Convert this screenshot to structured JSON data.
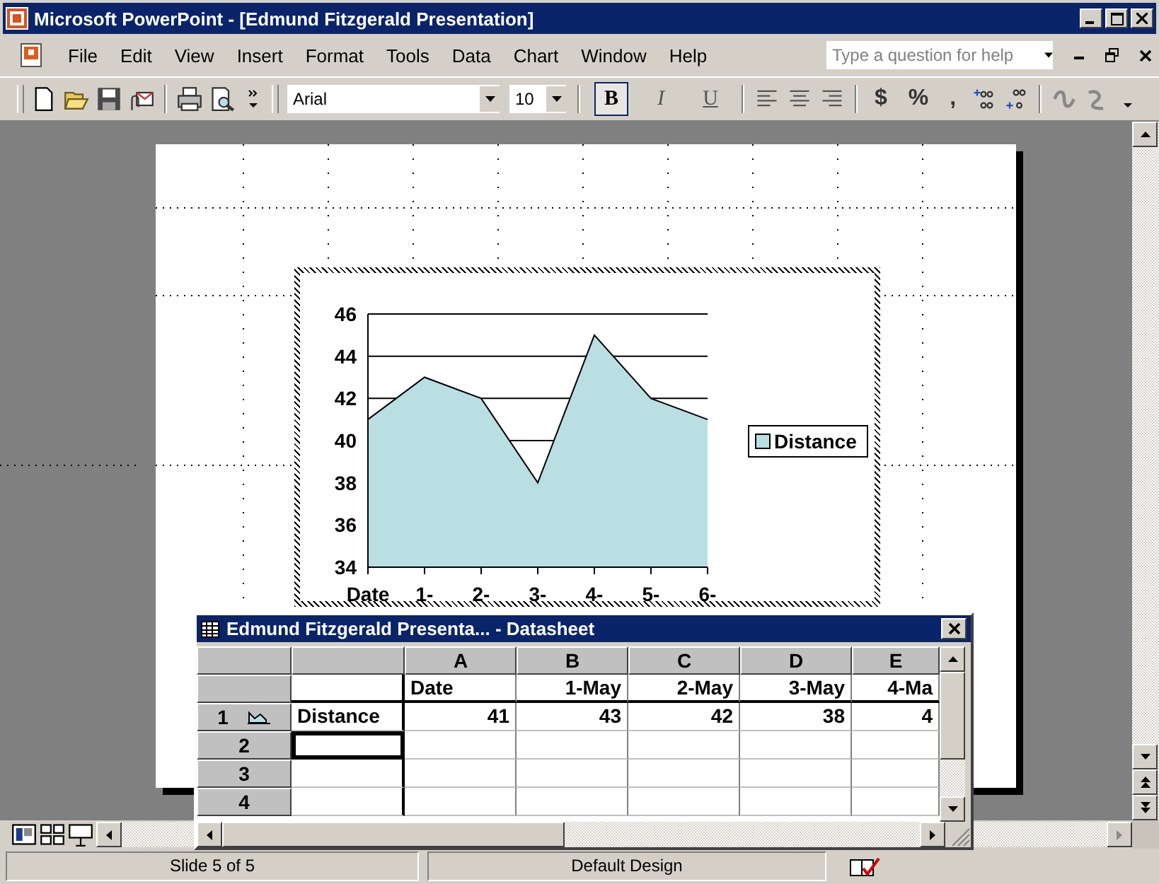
{
  "window": {
    "title": "Microsoft PowerPoint - [Edmund Fitzgerald Presentation]"
  },
  "menu": [
    "File",
    "Edit",
    "View",
    "Insert",
    "Format",
    "Tools",
    "Data",
    "Chart",
    "Window",
    "Help"
  ],
  "help_box": {
    "placeholder": "Type a question for help"
  },
  "toolbar": {
    "font": "Arial",
    "size": "10",
    "format_buttons": [
      {
        "label": "B",
        "pressed": true
      },
      {
        "label": "I",
        "pressed": false
      },
      {
        "label": "U",
        "pressed": false
      }
    ],
    "number_buttons": [
      "$",
      "%",
      ","
    ]
  },
  "slide_chart": {
    "chart_data": {
      "type": "area",
      "grid": true,
      "categories": [
        "Date",
        "1-",
        "2-",
        "3-",
        "4-",
        "5-",
        "6-"
      ],
      "series": [
        {
          "name": "Distance",
          "color": "#b9dfe3",
          "values": [
            41,
            43,
            42,
            38,
            45,
            42,
            41
          ]
        }
      ],
      "ylim": [
        34,
        46
      ],
      "yticks": [
        34,
        36,
        38,
        40,
        42,
        44,
        46
      ]
    }
  },
  "datasheet": {
    "title": "Edmund Fitzgerald Presenta... - Datasheet",
    "columns": [
      "A",
      "B",
      "C",
      "D",
      "E"
    ],
    "header_row": {
      "cells": [
        "Date",
        "1-May",
        "2-May",
        "3-May",
        "4-Ma"
      ]
    },
    "rows": [
      {
        "number": "1",
        "label": "Distance",
        "label_selected": false,
        "series_icon": true,
        "cells": [
          "41",
          "43",
          "42",
          "38",
          "4"
        ]
      },
      {
        "number": "2",
        "label": "",
        "label_selected": true,
        "series_icon": false,
        "cells": []
      },
      {
        "number": "3",
        "label": "",
        "label_selected": false,
        "series_icon": false,
        "cells": []
      },
      {
        "number": "4",
        "label": "",
        "label_selected": false,
        "series_icon": false,
        "cells": []
      }
    ]
  },
  "status_bar": {
    "slide": "Slide 5 of 5",
    "design": "Default Design"
  }
}
